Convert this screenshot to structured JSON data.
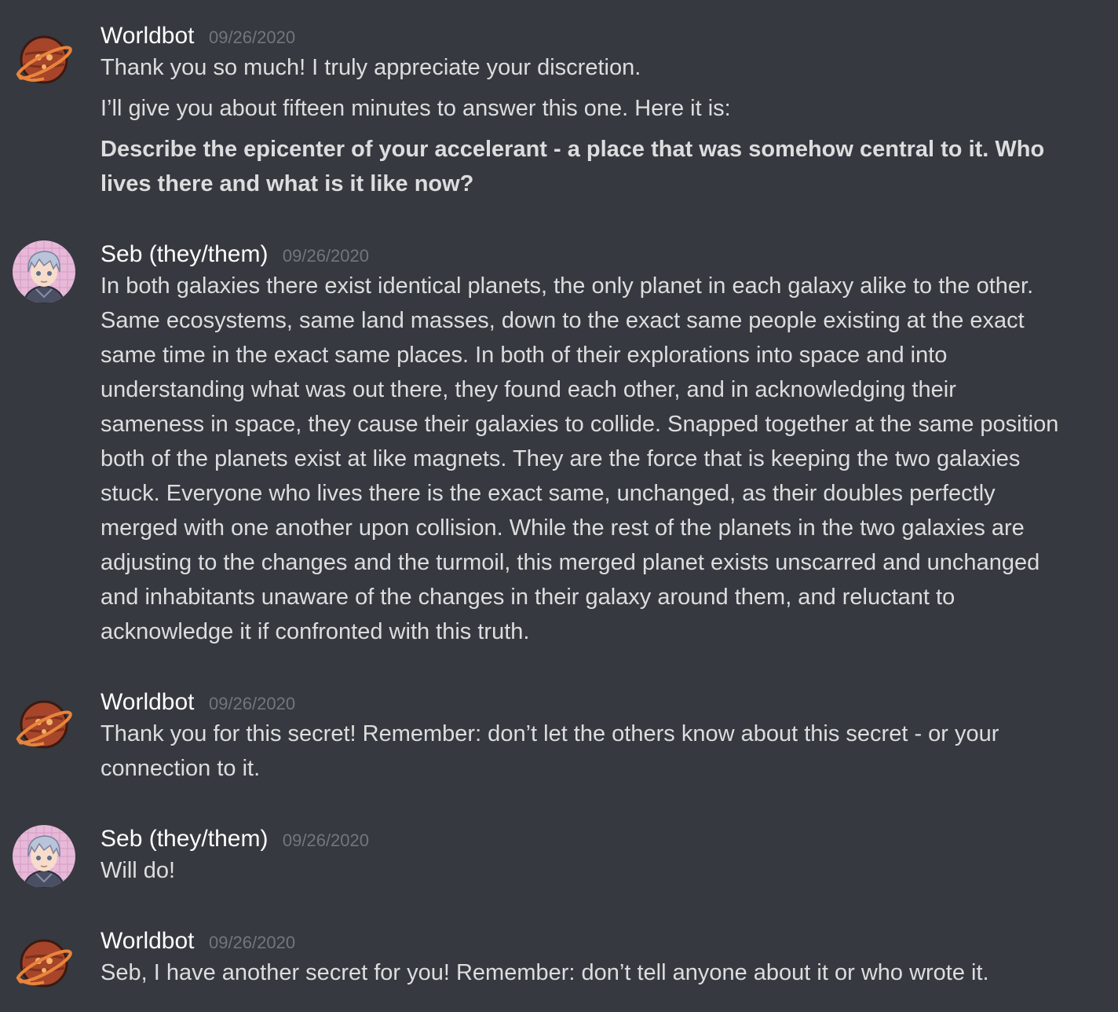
{
  "colors": {
    "background": "#36393f",
    "username": "#ffffff",
    "timestamp": "#72767d",
    "message_text": "#dcddde",
    "worldbot_avatar": "#a6452a",
    "seb_avatar_bg": "#e7b9d8"
  },
  "messages": [
    {
      "author": "Worldbot",
      "avatar_icon": "planet-avatar-icon",
      "timestamp": "09/26/2020",
      "paragraphs": [
        {
          "text": "Thank you so much! I truly appreciate your discretion."
        },
        {
          "text": "I’ll give you about fifteen minutes to answer this one. Here it is:"
        },
        {
          "lines": [
            "Describe the epicenter of your accelerant - a place that was somehow central to it. Who",
            "lives there and what is it like now?"
          ]
        }
      ]
    },
    {
      "author": "Seb (they/them)",
      "avatar_icon": "character-avatar-icon",
      "timestamp": "09/26/2020",
      "lines": [
        "In both galaxies there exist identical planets, the only planet in each galaxy alike to the other.",
        "Same ecosystems, same land masses, down to the exact same people existing at the exact",
        "same time in the exact same places. In both of their explorations into space and into",
        "understanding what was out there, they found each other, and in acknowledging their",
        "sameness in space, they cause their galaxies to collide. Snapped together at the same position",
        "both of the planets exist at like magnets. They are the force that is keeping the two galaxies",
        "stuck. Everyone who lives there is the exact same, unchanged, as their doubles perfectly",
        "merged with one another upon collision. While the rest of the planets in the two galaxies are",
        "adjusting to the changes and the turmoil, this merged planet exists unscarred and unchanged",
        "and inhabitants unaware of the changes in their galaxy around them, and reluctant to",
        "acknowledge it if confronted with this truth."
      ]
    },
    {
      "author": "Worldbot",
      "avatar_icon": "planet-avatar-icon",
      "timestamp": "09/26/2020",
      "lines": [
        "Thank you for this secret! Remember: don’t let the others know about this secret - or your",
        "connection to it."
      ]
    },
    {
      "author": "Seb (they/them)",
      "avatar_icon": "character-avatar-icon",
      "timestamp": "09/26/2020",
      "lines": [
        "Will do!"
      ]
    },
    {
      "author": "Worldbot",
      "avatar_icon": "planet-avatar-icon",
      "timestamp": "09/26/2020",
      "lines": [
        "Seb, I have another secret for you! Remember: don’t tell anyone about it or who wrote it."
      ]
    }
  ]
}
